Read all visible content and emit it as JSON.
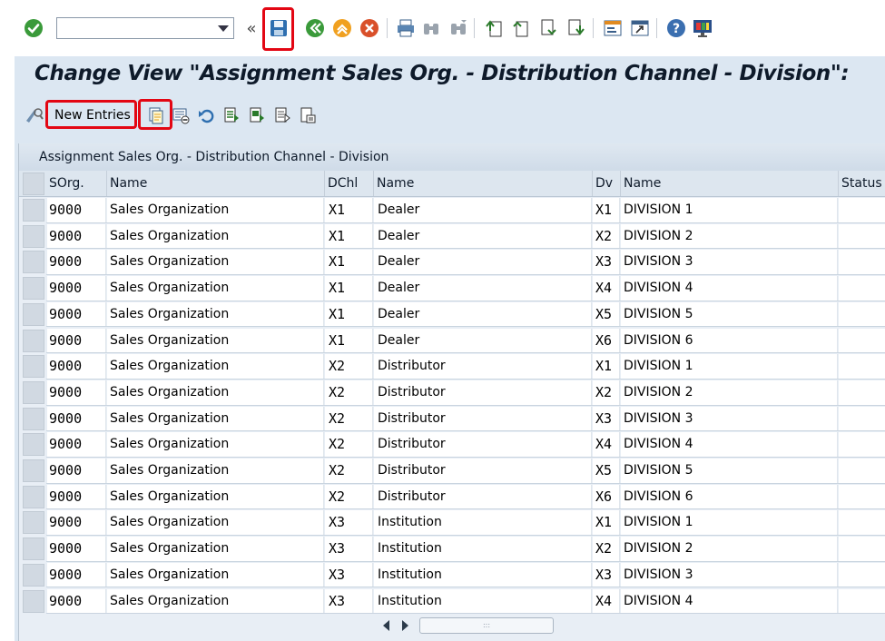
{
  "toolbar": {
    "command_field": {
      "value": "",
      "placeholder": ""
    },
    "collapse_glyph": "«",
    "icons": [
      "enter-icon",
      "save-icon",
      "back-icon",
      "exit-icon",
      "cancel-icon",
      "print-icon",
      "find-icon",
      "find-next-icon",
      "first-page-icon",
      "previous-page-icon",
      "next-page-icon",
      "last-page-icon",
      "create-session-icon",
      "generate-shortcut-icon",
      "help-icon",
      "customize-layout-icon"
    ]
  },
  "page": {
    "title": "Change View \"Assignment Sales Org. - Distribution Channel - Division\":"
  },
  "app_toolbar": {
    "new_entries_label": "New Entries"
  },
  "table": {
    "title": "Assignment Sales Org. - Distribution Channel - Division",
    "columns": [
      "SOrg.",
      "Name",
      "DChl",
      "Name",
      "Dv",
      "Name",
      "Status"
    ],
    "rows": [
      [
        "9000",
        "Sales Organization",
        "X1",
        "Dealer",
        "X1",
        "DIVISION 1",
        ""
      ],
      [
        "9000",
        "Sales Organization",
        "X1",
        "Dealer",
        "X2",
        "DIVISION 2",
        ""
      ],
      [
        "9000",
        "Sales Organization",
        "X1",
        "Dealer",
        "X3",
        "DIVISION 3",
        ""
      ],
      [
        "9000",
        "Sales Organization",
        "X1",
        "Dealer",
        "X4",
        "DIVISION 4",
        ""
      ],
      [
        "9000",
        "Sales Organization",
        "X1",
        "Dealer",
        "X5",
        "DIVISION 5",
        ""
      ],
      [
        "9000",
        "Sales Organization",
        "X1",
        "Dealer",
        "X6",
        "DIVISION 6",
        ""
      ],
      [
        "9000",
        "Sales Organization",
        "X2",
        "Distributor",
        "X1",
        "DIVISION 1",
        ""
      ],
      [
        "9000",
        "Sales Organization",
        "X2",
        "Distributor",
        "X2",
        "DIVISION 2",
        ""
      ],
      [
        "9000",
        "Sales Organization",
        "X2",
        "Distributor",
        "X3",
        "DIVISION 3",
        ""
      ],
      [
        "9000",
        "Sales Organization",
        "X2",
        "Distributor",
        "X4",
        "DIVISION 4",
        ""
      ],
      [
        "9000",
        "Sales Organization",
        "X2",
        "Distributor",
        "X5",
        "DIVISION 5",
        ""
      ],
      [
        "9000",
        "Sales Organization",
        "X2",
        "Distributor",
        "X6",
        "DIVISION 6",
        ""
      ],
      [
        "9000",
        "Sales Organization",
        "X3",
        "Institution",
        "X1",
        "DIVISION 1",
        ""
      ],
      [
        "9000",
        "Sales Organization",
        "X3",
        "Institution",
        "X2",
        "DIVISION 2",
        ""
      ],
      [
        "9000",
        "Sales Organization",
        "X3",
        "Institution",
        "X3",
        "DIVISION 3",
        ""
      ],
      [
        "9000",
        "Sales Organization",
        "X3",
        "Institution",
        "X4",
        "DIVISION 4",
        ""
      ]
    ],
    "scrollbar_grip": ":::"
  },
  "colors": {
    "highlight": "#e30613",
    "frame_bg": "#dce7f2",
    "title_text": "#0e1a2a"
  }
}
